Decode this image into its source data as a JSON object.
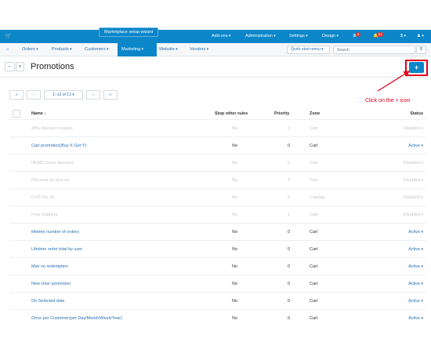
{
  "topbar": {
    "wizard": "Marketplace setup wizard",
    "addons": "Add-ons",
    "administration": "Administration",
    "settings": "Settings",
    "design": "Design",
    "badge1": "9",
    "badge2": "51",
    "currency": "$",
    "color": "#0b86c9"
  },
  "nav": {
    "orders": "Orders",
    "products": "Products",
    "customers": "Customers",
    "marketing": "Marketing",
    "website": "Website",
    "vendors": "Vendors",
    "quick_start": "Quick start menu",
    "search_placeholder": "Search"
  },
  "page": {
    "title": "Promotions",
    "add_label": "+"
  },
  "annotation": {
    "hint": "Click on the + icon",
    "color": "#e0001b"
  },
  "pagination": {
    "first": "«",
    "prev": "‹",
    "range": "1–13 of 13",
    "next": "›",
    "last": "»"
  },
  "table": {
    "headers": {
      "name": "Name",
      "stop": "Stop other rules",
      "priority": "Priority",
      "zone": "Zone",
      "status": "Status"
    },
    "rows": [
      {
        "name": "20% discount coupon",
        "stop": "No",
        "priority": "3",
        "zone": "Cart",
        "status": "Disabled"
      },
      {
        "name": "Cart promotion(Buy X Get Y)",
        "stop": "No",
        "priority": "0",
        "zone": "Cart",
        "status": "Active"
      },
      {
        "name": "DEMO Store discount",
        "stop": "No",
        "priority": "5",
        "zone": "Cart",
        "status": "Disabled"
      },
      {
        "name": "Discount on pick-up",
        "stop": "No",
        "priority": "4",
        "zone": "Cart",
        "status": "Disabled"
      },
      {
        "name": "DVD 5% off",
        "stop": "No",
        "priority": "0",
        "zone": "Catalog",
        "status": "Disabled"
      },
      {
        "name": "Free shipping",
        "stop": "No",
        "priority": "1",
        "zone": "Cart",
        "status": "Disabled"
      },
      {
        "name": "lifetime number of orders",
        "stop": "No",
        "priority": "0",
        "zone": "Cart",
        "status": "Active"
      },
      {
        "name": "Lifetime order total by user",
        "stop": "No",
        "priority": "0",
        "zone": "Cart",
        "status": "Active"
      },
      {
        "name": "Max no redemption",
        "stop": "No",
        "priority": "0",
        "zone": "Cart",
        "status": "Active"
      },
      {
        "name": "New User promotion",
        "stop": "No",
        "priority": "0",
        "zone": "Cart",
        "status": "Active"
      },
      {
        "name": "On Selected date",
        "stop": "No",
        "priority": "0",
        "zone": "Cart",
        "status": "Active"
      },
      {
        "name": "Once per Customer(per Day/Month/Week/Year)",
        "stop": "No",
        "priority": "0",
        "zone": "Cart",
        "status": "Active"
      }
    ]
  }
}
